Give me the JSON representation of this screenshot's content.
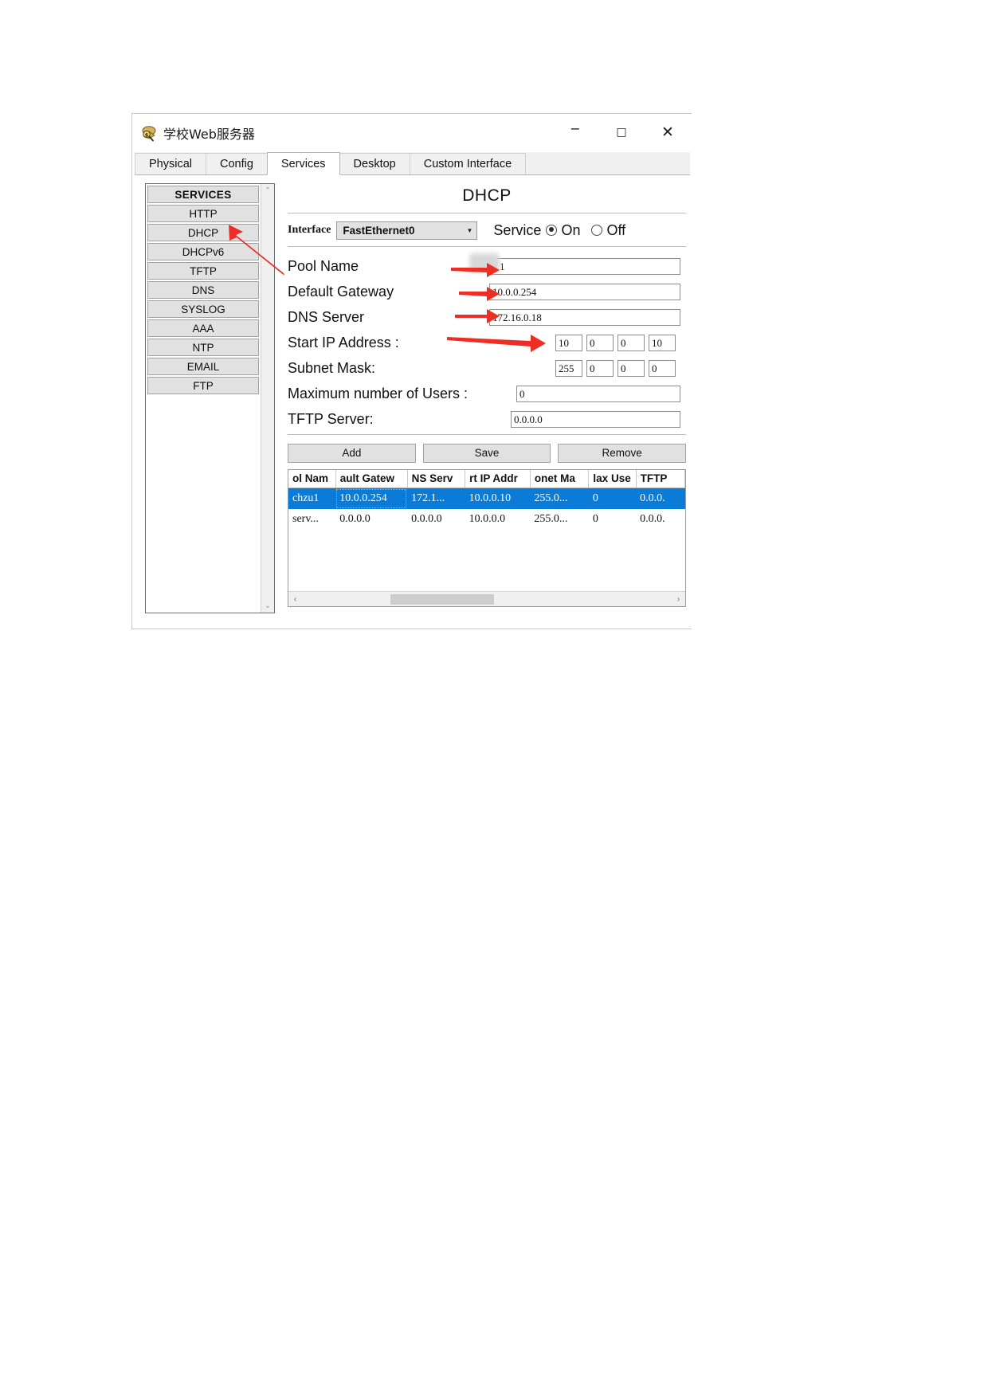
{
  "window": {
    "title": "学校Web服务器",
    "icon": "packet-tracer-server-icon",
    "minimize": "−",
    "maximize": "□",
    "close": "✕"
  },
  "tabs": [
    {
      "label": "Physical",
      "selected": false
    },
    {
      "label": "Config",
      "selected": false
    },
    {
      "label": "Services",
      "selected": true
    },
    {
      "label": "Desktop",
      "selected": false
    },
    {
      "label": "Custom Interface",
      "selected": false
    }
  ],
  "sidebar": {
    "header": "SERVICES",
    "items": [
      {
        "label": "HTTP"
      },
      {
        "label": "DHCP"
      },
      {
        "label": "DHCPv6"
      },
      {
        "label": "TFTP"
      },
      {
        "label": "DNS"
      },
      {
        "label": "SYSLOG"
      },
      {
        "label": "AAA"
      },
      {
        "label": "NTP"
      },
      {
        "label": "EMAIL"
      },
      {
        "label": "FTP"
      }
    ],
    "scroll_up": "⌃",
    "scroll_down": "⌄"
  },
  "main": {
    "title": "DHCP",
    "interface_label": "Interface",
    "interface_value": "FastEthernet0",
    "interface_caret": "▼",
    "service_label": "Service",
    "service_on": "On",
    "service_off": "Off",
    "service_state": "on",
    "fields": {
      "pool_name_label": "Pool Name",
      "pool_name_value": "c      1",
      "default_gateway_label": "Default Gateway",
      "default_gateway_value": "10.0.0.254",
      "dns_server_label": "DNS Server",
      "dns_server_value": "172.16.0.18",
      "start_ip_label": "Start IP Address :",
      "start_ip_octets": [
        "10",
        "0",
        "0",
        "10"
      ],
      "subnet_mask_label": "Subnet Mask:",
      "subnet_mask_octets": [
        "255",
        "0",
        "0",
        "0"
      ],
      "max_users_label": "Maximum number of Users :",
      "max_users_value": "0",
      "tftp_server_label": "TFTP Server:",
      "tftp_server_value": "0.0.0.0"
    },
    "buttons": {
      "add": "Add",
      "save": "Save",
      "remove": "Remove"
    },
    "table": {
      "headers": [
        "ol Nam",
        "ault Gatew",
        "NS Serv",
        "rt IP Addr",
        "onet Ma",
        "lax Use",
        "TFTP"
      ],
      "rows": [
        {
          "selected": true,
          "cells": [
            "chzu1",
            "10.0.0.254",
            "172.1...",
            "10.0.0.10",
            "255.0...",
            "0",
            "0.0.0."
          ]
        },
        {
          "selected": false,
          "cells": [
            "serv...",
            "0.0.0.0",
            "0.0.0.0",
            "10.0.0.0",
            "255.0...",
            "0",
            "0.0.0."
          ]
        }
      ],
      "scroll_left": "‹",
      "scroll_right": "›"
    }
  },
  "annotations": {
    "color": "#ee2d24",
    "arrows": [
      {
        "name": "arrow-to-dhcp-menu"
      },
      {
        "name": "arrow-to-pool-name"
      },
      {
        "name": "arrow-to-default-gateway"
      },
      {
        "name": "arrow-to-dns-server"
      },
      {
        "name": "arrow-to-start-ip"
      }
    ]
  }
}
